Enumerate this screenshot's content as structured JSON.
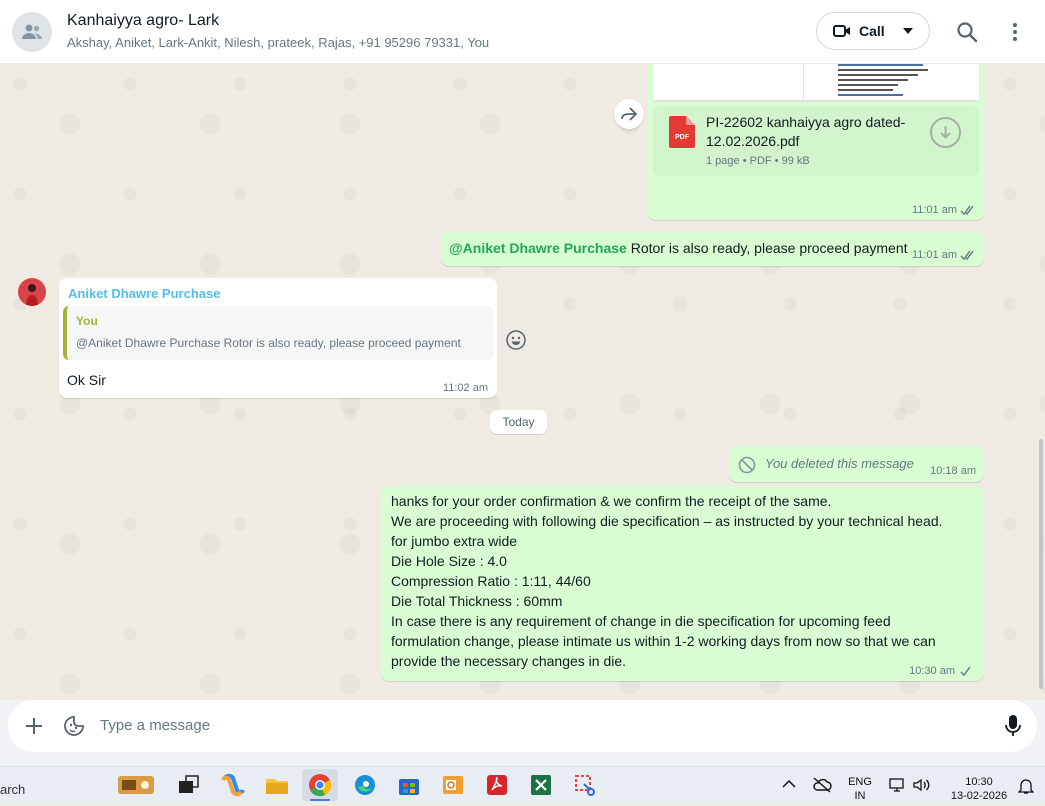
{
  "header": {
    "title": "Kanhaiyya agro- Lark",
    "members": "Akshay, Aniket, Lark-Ankit, Nilesh, prateek, Rajas, +91 95296 79331, You",
    "call_label": "Call"
  },
  "messages": {
    "doc": {
      "name": "PI-22602 kanhaiyya agro dated-12.02.2026.pdf",
      "info": "1 page • PDF • 99 kB",
      "time": "11:01 am"
    },
    "mention_msg": {
      "mention": "@Aniket Dhawre Purchase",
      "text": " Rotor is also ready, please proceed payment",
      "time": "11:01 am"
    },
    "reply_msg": {
      "sender": "Aniket Dhawre Purchase",
      "quote_author": "You",
      "quote_text": "@Aniket Dhawre Purchase Rotor is also ready, please proceed payment",
      "text": "Ok Sir",
      "time": "11:02 am"
    },
    "date_separator": "Today",
    "deleted_msg": {
      "text": "You deleted this message",
      "time": "10:18 am"
    },
    "long_msg": {
      "lines": [
        "hanks for your order confirmation & we confirm the receipt of the same.",
        "We are proceeding with following die specification –  as instructed by your technical head.",
        "for jumbo extra wide",
        "Die Hole Size : 4.0",
        "Compression Ratio : 1:11, 44/60",
        "Die Total Thickness : 60mm",
        "In case there is any requirement of change in die specification for upcoming feed",
        "formulation change, please intimate us within 1-2 working days from now so that we can",
        "provide the necessary changes in die."
      ],
      "time": "10:30 am"
    }
  },
  "composer": {
    "placeholder": "Type a message"
  },
  "taskbar": {
    "search_fragment": "arch",
    "language": "ENG",
    "region": "IN",
    "time": "10:30",
    "date": "13-02-2026"
  },
  "colors": {
    "outgoing_bubble": "#d9fdd3",
    "incoming_bubble": "#ffffff",
    "mention": "#1fa855",
    "sender_name": "#53bdeb",
    "quote_bar": "#a5b337",
    "read_tick": "#53bdeb"
  }
}
